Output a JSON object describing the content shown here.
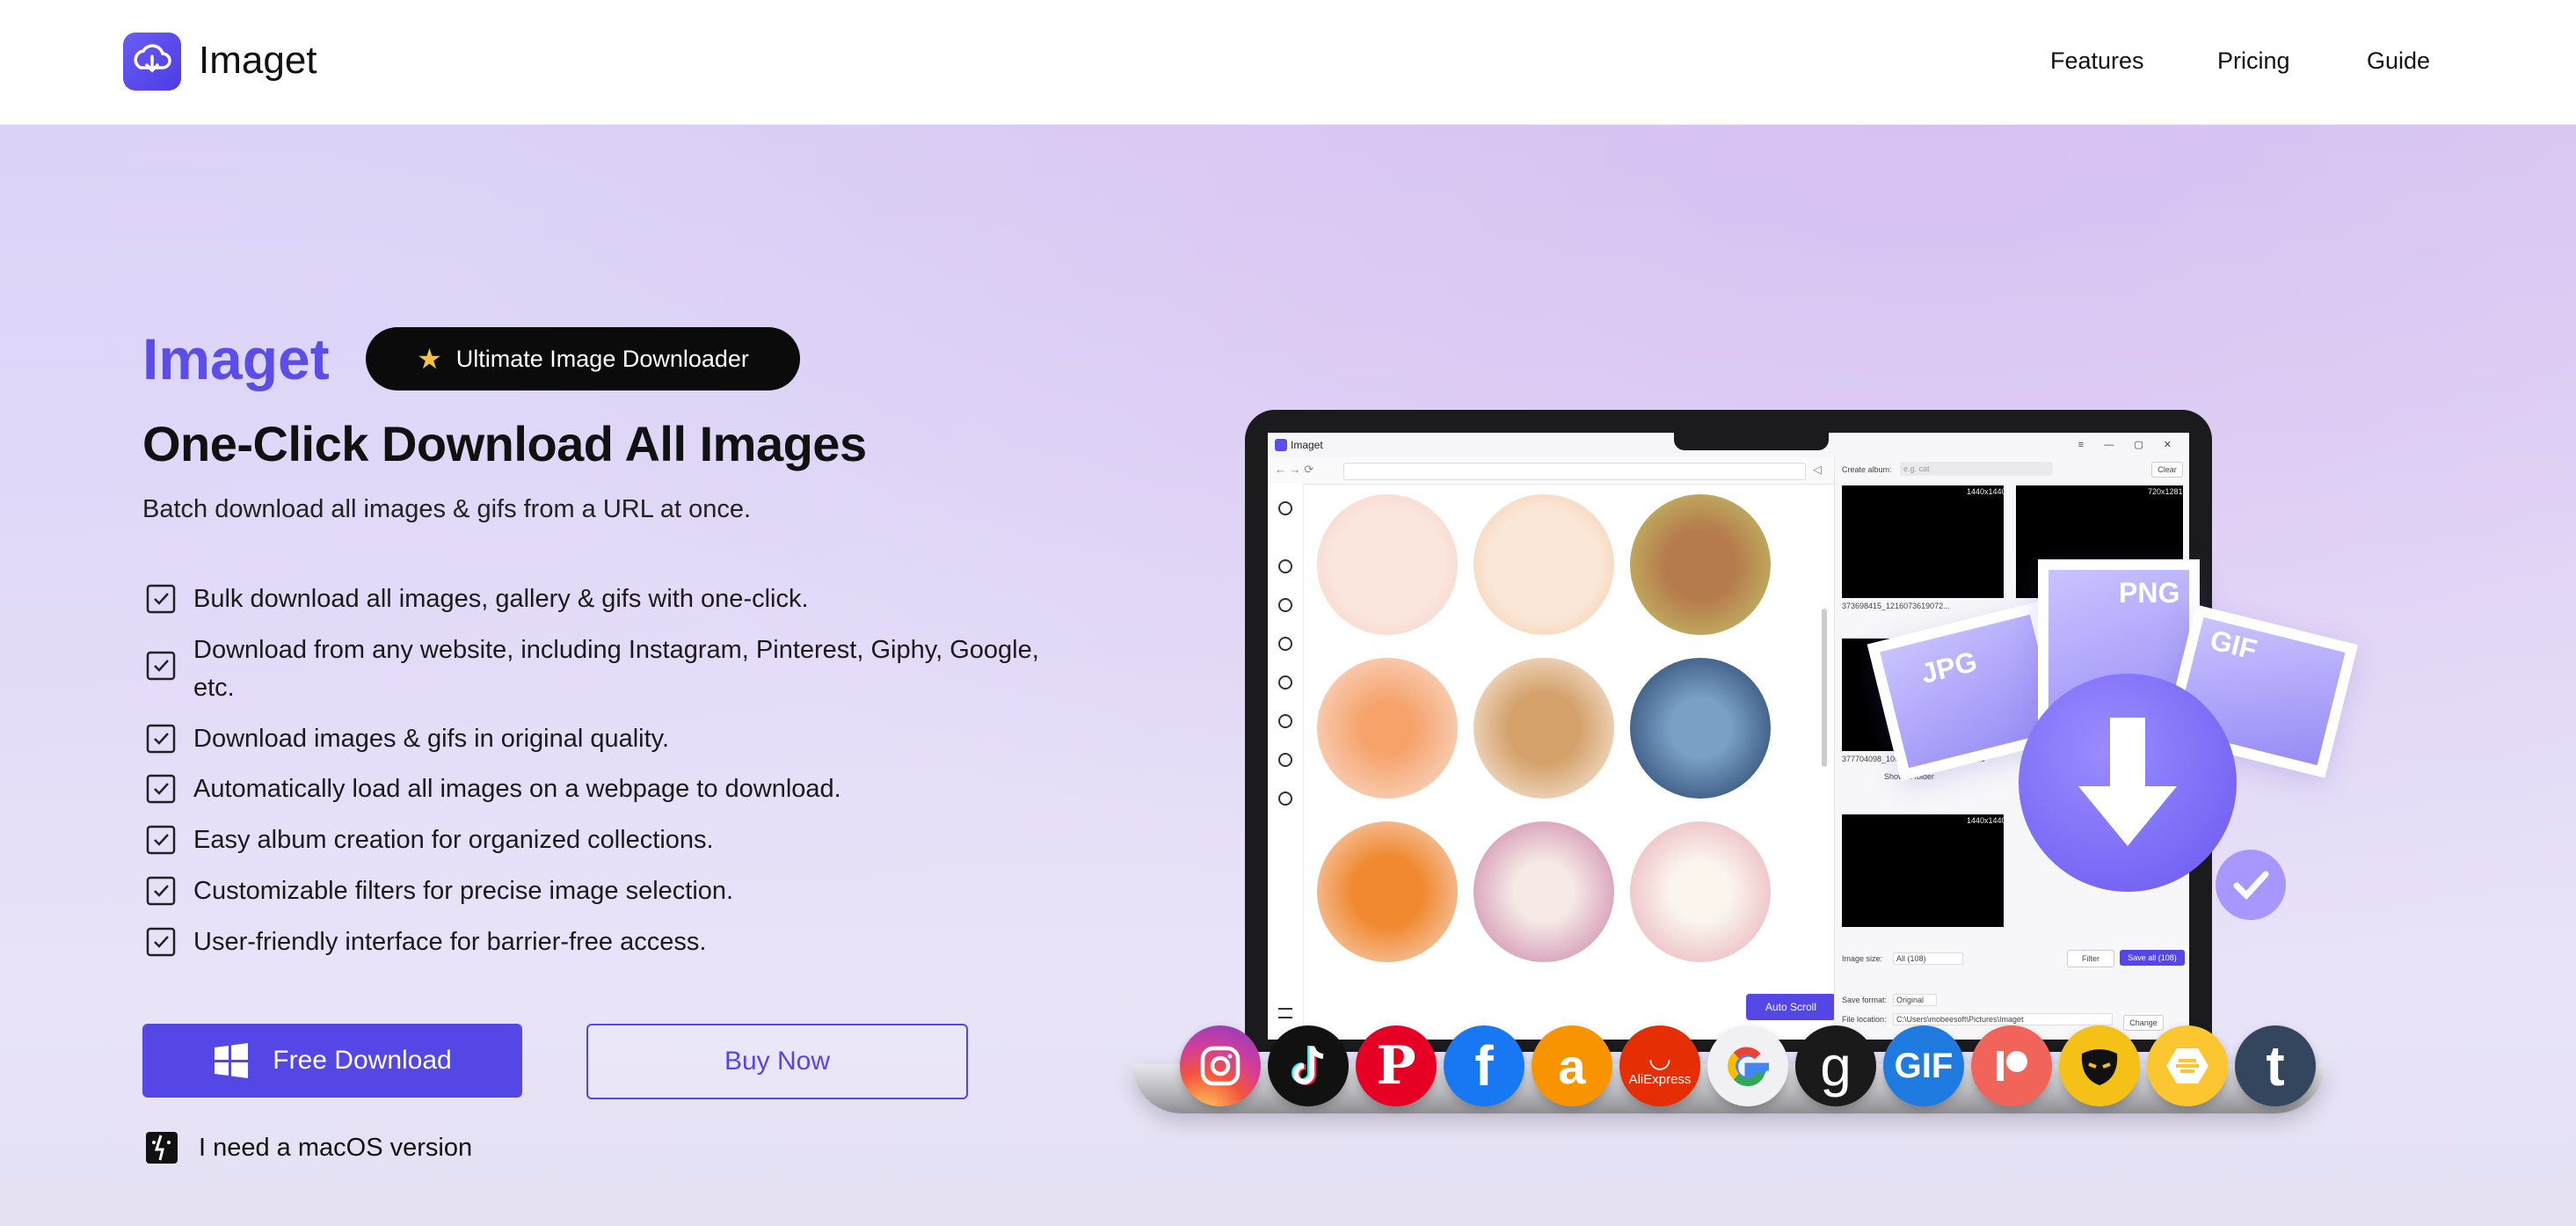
{
  "header": {
    "brand": "Imaget",
    "nav": [
      {
        "label": "Features"
      },
      {
        "label": "Pricing"
      },
      {
        "label": "Guide"
      }
    ]
  },
  "hero": {
    "brand": "Imaget",
    "badge": "Ultimate Image Downloader",
    "title": "One-Click Download All Images",
    "subtitle": "Batch download all images & gifs from a URL at once.",
    "features": [
      "Bulk download all images, gallery & gifs with one-click.",
      "Download from any website, including Instagram, Pinterest, Giphy, Google, etc.",
      "Download images & gifs in original quality.",
      "Automatically load all images on a webpage to download.",
      "Easy album creation for organized collections.",
      "Customizable filters for precise image selection.",
      "User-friendly interface for barrier-free access."
    ],
    "primary_button": "Free Download",
    "secondary_button": "Buy Now",
    "mac_link": "I need a macOS version"
  },
  "app_preview": {
    "window_title": "Imaget",
    "create_album_label": "Create album:",
    "album_placeholder": "e.g. cat",
    "clear_button": "Clear",
    "auto_scroll_button": "Auto Scroll",
    "image_size_label": "Image size:",
    "image_size_value": "All (108)",
    "filter_button": "Filter",
    "save_all_button": "Save all (108)",
    "save_format_label": "Save format:",
    "save_format_value": "Original",
    "file_location_label": "File location:",
    "file_location_value": "C:\\Users\\mobeesoft\\Pictures\\Imaget",
    "change_button": "Change",
    "file_name_1": "373698415_1216073619072...",
    "file_name_2": "377704098_1063131715...a95676_2126",
    "show_in_folder": "Show in folder",
    "size_tag_1": "1440x1440",
    "size_tag_2": "720x1281",
    "size_tag_3": "1440x1440",
    "format_tags": [
      "JPG",
      "PNG",
      "GIF"
    ]
  },
  "social_icons": [
    "instagram-icon",
    "tiktok-icon",
    "pinterest-icon",
    "facebook-icon",
    "amazon-icon",
    "aliexpress-icon",
    "google-icon",
    "goodreads-icon",
    "giphy-icon",
    "patreon-icon",
    "grindr-icon",
    "bumble-icon",
    "tumblr-icon"
  ],
  "social_labels": {
    "aliexpress": "AliExpress",
    "giphy": "GIF"
  },
  "colors": {
    "accent": "#5546e6",
    "brand_text": "#5b4ee8",
    "badge_bg": "#0b0b0b"
  }
}
